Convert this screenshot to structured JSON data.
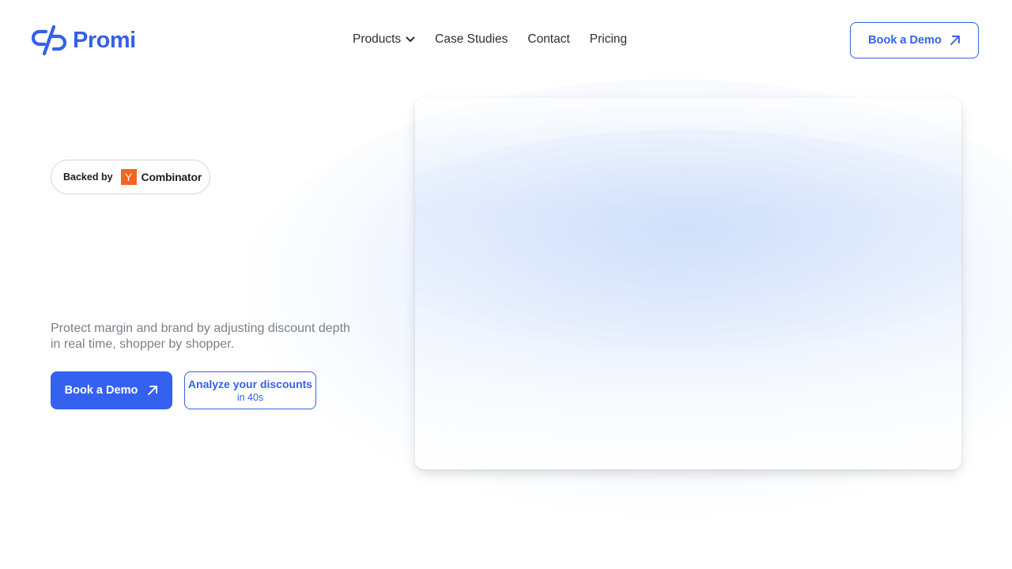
{
  "header": {
    "logo_text": "Promi",
    "nav": [
      {
        "label": "Products",
        "has_dropdown": true
      },
      {
        "label": "Case Studies",
        "has_dropdown": false
      },
      {
        "label": "Contact",
        "has_dropdown": false
      },
      {
        "label": "Pricing",
        "has_dropdown": false
      }
    ],
    "cta_label": "Book a Demo"
  },
  "hero": {
    "badge": {
      "backed_by": "Backed by",
      "yc_mark": "Y",
      "yc_word": "Combinator"
    },
    "tagline": "Protect margin and brand by adjusting discount depth in real time, shopper by shopper.",
    "primary_cta": "Book a Demo",
    "secondary_cta": {
      "line1": "Analyze your discounts",
      "line2": "in 40s"
    }
  },
  "colors": {
    "brand": "#3461e8",
    "primary_button": "#3461f0",
    "yc_orange": "#f26522",
    "text_dark": "#2b2f38",
    "text_muted": "#7b7f88"
  },
  "icons": {
    "logo": "promi-logo-icon",
    "dropdown": "chevron-down-icon",
    "cta_arrow": "arrow-up-right-icon"
  }
}
